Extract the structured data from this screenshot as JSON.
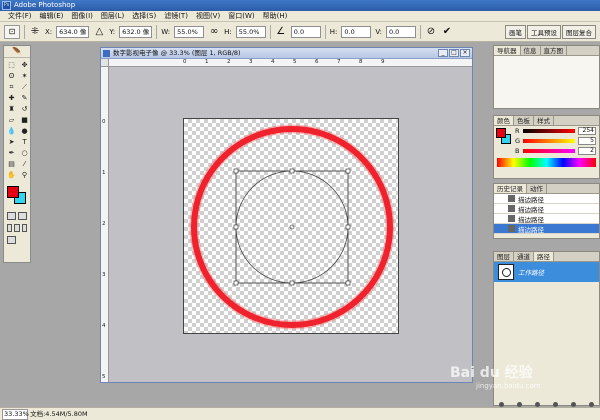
{
  "app": {
    "title": "Adobe Photoshop"
  },
  "menubar": [
    "文件(F)",
    "编辑(E)",
    "图像(I)",
    "图层(L)",
    "选择(S)",
    "滤镜(T)",
    "视图(V)",
    "窗口(W)",
    "帮助(H)"
  ],
  "options": {
    "x_label": "X:",
    "x_value": "634.0 像",
    "y_label": "Y:",
    "y_value": "632.0 像",
    "w_label": "W:",
    "w_value": "55.0%",
    "h_label": "H:",
    "h_value": "55.0%",
    "angle_value": "0.0",
    "hskew_label": "H:",
    "hskew_value": "0.0",
    "vskew_label": "V:",
    "vskew_value": "0.0",
    "cancel_icon": "cancel-icon",
    "commit_icon": "checkmark-icon"
  },
  "palette_well": [
    "画笔",
    "工具预设",
    "图层复合"
  ],
  "document": {
    "title": "数字影视电子像 @ 33.3% (图层 1, RGB/8)",
    "ruler_top": [
      "0",
      "1",
      "2",
      "3",
      "4",
      "5",
      "6",
      "7",
      "8",
      "9"
    ],
    "ruler_left": [
      "0",
      "1",
      "2",
      "3",
      "4",
      "5"
    ]
  },
  "status": {
    "zoom": "33.33%",
    "doc_info": "文档:4.54M/5.80M"
  },
  "panels": {
    "navigator_tabs": [
      "导航器",
      "信息",
      "直方图"
    ],
    "color_tabs": [
      "颜色",
      "色板",
      "样式"
    ],
    "color": {
      "channels": [
        {
          "label": "R",
          "value": "254"
        },
        {
          "label": "G",
          "value": "5"
        },
        {
          "label": "B",
          "value": "2"
        }
      ],
      "foreground": "#e60012",
      "background": "#30d6f0"
    },
    "history_tabs": [
      "历史记录",
      "动作"
    ],
    "history": [
      "描边路径",
      "描边路径",
      "描边路径",
      "描边路径"
    ],
    "layers_tabs": [
      "图层",
      "通道",
      "路径"
    ],
    "path_item": "工作路径"
  },
  "watermark": {
    "brand": "Bai du 经验",
    "url": "jingyan.baidu.com"
  },
  "colors": {
    "accent": "#3a78d2",
    "stroke": "#e60012"
  }
}
